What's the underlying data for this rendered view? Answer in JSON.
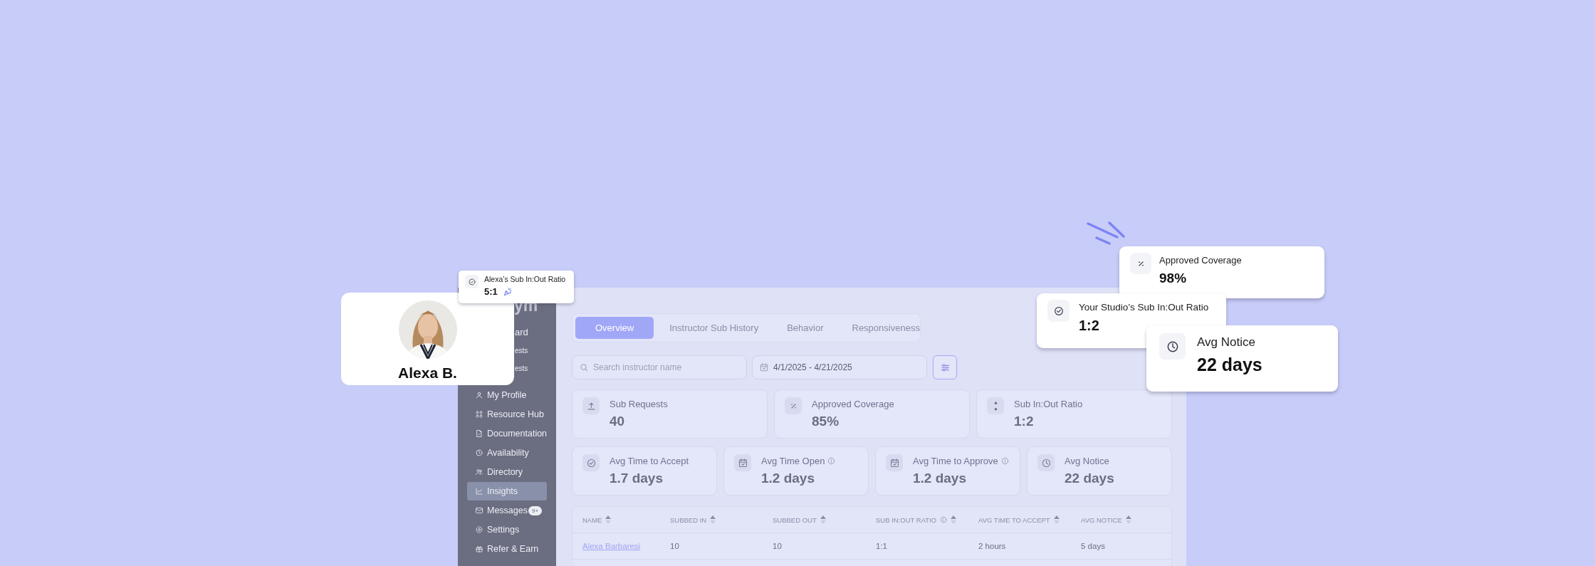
{
  "sidebar": {
    "logo": "ym",
    "items": [
      {
        "kind": "covered",
        "label": "ard",
        "selected": false
      },
      {
        "kind": "covered_sub",
        "label": "ests",
        "selected": false
      },
      {
        "kind": "covered_sub",
        "label": "ests",
        "selected": false
      },
      {
        "kind": "nav",
        "label": "My Profile",
        "selected": false
      },
      {
        "kind": "nav",
        "label": "Resource Hub",
        "selected": false
      },
      {
        "kind": "nav",
        "label": "Documentation",
        "selected": false
      },
      {
        "kind": "nav",
        "label": "Availability",
        "selected": false
      },
      {
        "kind": "nav",
        "label": "Directory",
        "selected": false
      },
      {
        "kind": "nav",
        "label": "Insights",
        "selected": true
      },
      {
        "kind": "nav",
        "label": "Messages",
        "badge": "9+",
        "selected": false
      },
      {
        "kind": "nav",
        "label": "Settings",
        "selected": false
      },
      {
        "kind": "nav",
        "label": "Refer & Earn",
        "selected": false
      }
    ]
  },
  "main": {
    "tabs": [
      {
        "label": "Overview",
        "selected": true
      },
      {
        "label": "Instructor Sub History",
        "selected": false
      },
      {
        "label": "Behavior",
        "selected": false
      },
      {
        "label": "Responsiveness",
        "selected": false
      }
    ],
    "search": {
      "placeholder": "Search instructor name"
    },
    "date_range": {
      "value": "4/1/2025 - 4/21/2025"
    },
    "stat_rows": [
      [
        {
          "title": "Sub Requests",
          "value": "40",
          "info": false
        },
        {
          "title": "Approved Coverage",
          "value": "85%",
          "info": false
        },
        {
          "title": "Sub In:Out Ratio",
          "value": "1:2",
          "info": false
        }
      ],
      [
        {
          "title": "Avg Time to Accept",
          "value": "1.7 days",
          "info": false
        },
        {
          "title": "Avg Time Open",
          "value": "1.2 days",
          "info": true
        },
        {
          "title": "Avg Time to Approve",
          "value": "1.2 days",
          "info": true
        },
        {
          "title": "Avg Notice",
          "value": "22 days",
          "info": false
        }
      ]
    ],
    "table": {
      "columns": [
        {
          "label": "NAME",
          "info": false
        },
        {
          "label": "SUBBED IN",
          "info": false
        },
        {
          "label": "SUBBED OUT",
          "info": false
        },
        {
          "label": "SUB IN:OUT RATIO",
          "info": true
        },
        {
          "label": "AVG TIME TO ACCEPT",
          "info": false
        },
        {
          "label": "AVG NOTICE",
          "info": false
        }
      ],
      "rows": [
        {
          "cells": [
            "Alexa Barbaresi",
            "10",
            "10",
            "1:1",
            "2 hours",
            "5 days"
          ]
        }
      ]
    }
  },
  "profile_card": {
    "name": "Alexa B."
  },
  "ratio_tooltip": {
    "title": "Alexa’s Sub In:Out Ratio",
    "value": "5:1"
  },
  "highlight_cards": [
    {
      "title": "Approved Coverage",
      "value": "98%"
    },
    {
      "title": "Your Studio’s Sub In:Out Ratio",
      "value": "1:2"
    },
    {
      "title": "Avg Notice",
      "value": "22 days"
    }
  ]
}
